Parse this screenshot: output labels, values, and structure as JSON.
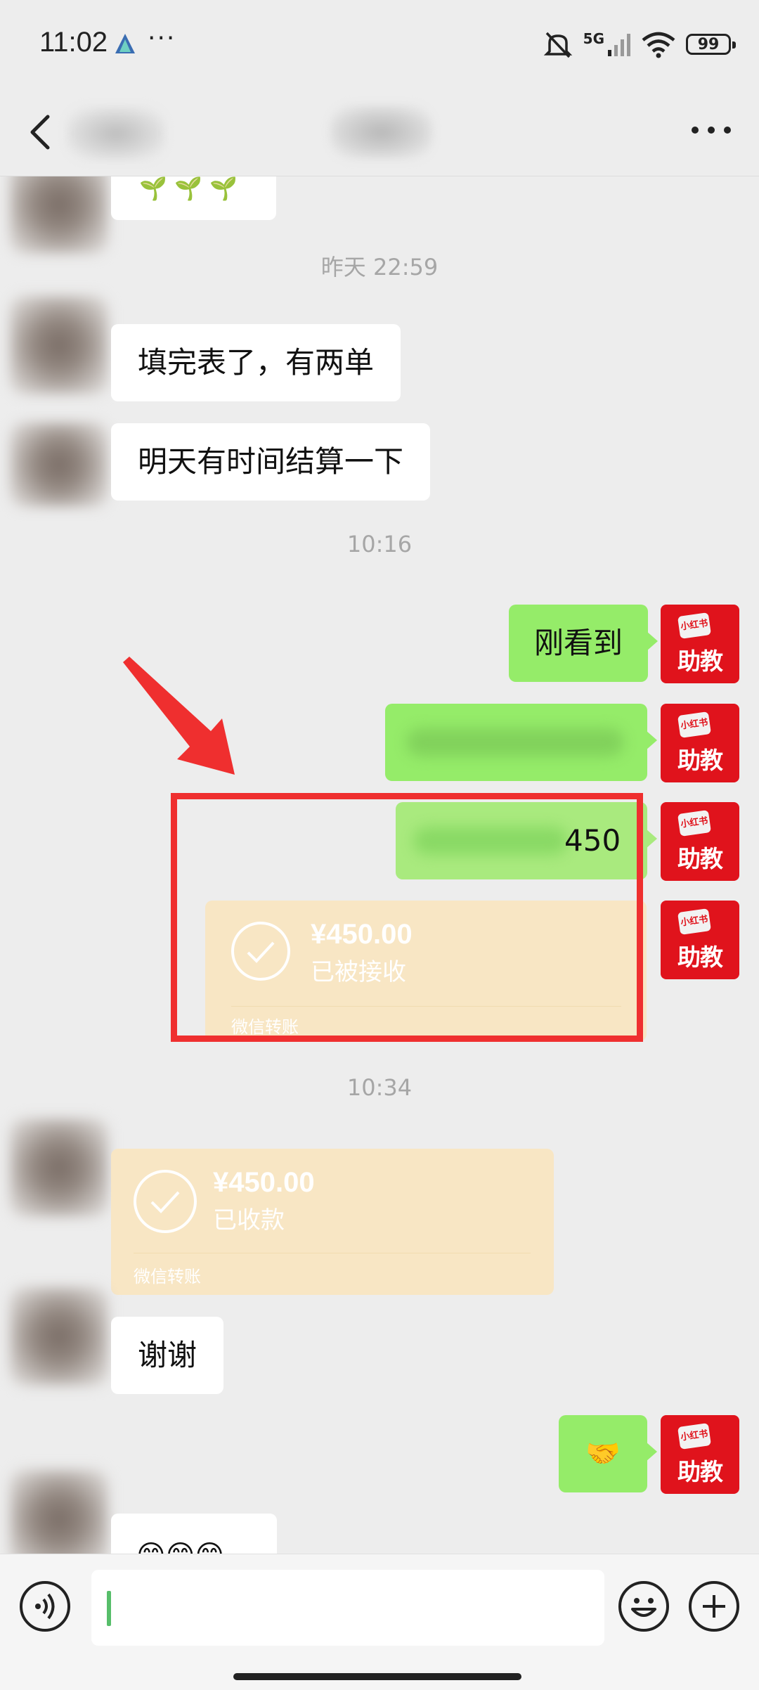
{
  "status_bar": {
    "time": "11:02",
    "more": "···",
    "network": "5G",
    "battery": "99",
    "icons": [
      "mute-icon",
      "signal-icon",
      "wifi-icon",
      "battery-icon"
    ]
  },
  "nav": {
    "back_icon": "chevron-left-icon",
    "more_icon": "ellipsis-icon"
  },
  "messages": {
    "t1": "昨天 22:59",
    "m1": "填完表了，有两单",
    "m2": "明天有时间结算一下",
    "t2": "10:16",
    "m3": "刚看到",
    "m5_suffix": "450",
    "transfer1": {
      "amount": "¥450.00",
      "status": "已被接收",
      "label": "微信转账"
    },
    "t3": "10:34",
    "transfer2": {
      "amount": "¥450.00",
      "status": "已收款",
      "label": "微信转账"
    },
    "m6": "谢谢",
    "m7_emoji": "🤝",
    "m8_emoji": "😁😁😁",
    "m0_emoji": "🌱 🌱 🌱"
  },
  "my_avatar": {
    "top_text": "小红书",
    "bottom_text": "助教"
  },
  "colors": {
    "bg": "#ededed",
    "my_bubble": "#95ec69",
    "transfer_card": "#f8e6c4",
    "annotation": "#ef2f2f",
    "avatar_red": "#e0131c"
  },
  "input": {
    "voice_icon": "voice-icon",
    "emoji_icon": "smiley-icon",
    "plus_icon": "plus-icon"
  }
}
